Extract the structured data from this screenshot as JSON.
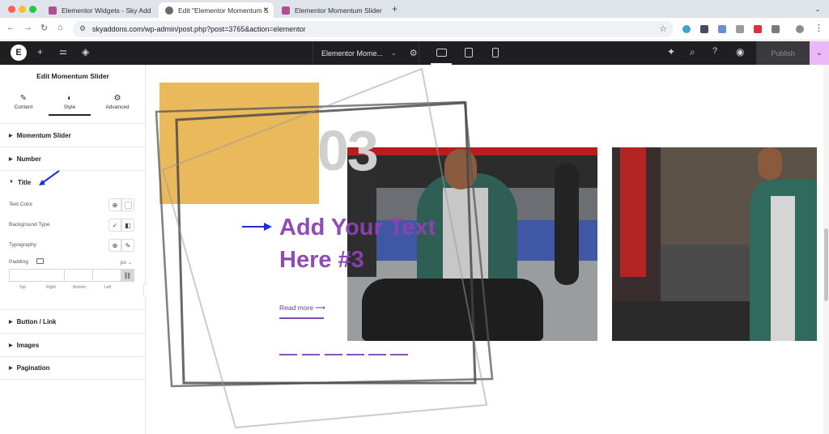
{
  "browser": {
    "tabs": [
      {
        "title": "Elementor Widgets - Sky Add",
        "active": false
      },
      {
        "title": "Edit \"Elementor Momentum S",
        "active": true
      },
      {
        "title": "Elementor Momentum Slider",
        "active": false
      }
    ],
    "new_tab": "+",
    "url": "skyaddons.com/wp-admin/post.php?post=3765&action=elementor"
  },
  "editor_bar": {
    "document_title": "Elementor Mome...",
    "publish_label": "Publish"
  },
  "panel": {
    "title": "Edit Momentum Slider",
    "tabs": [
      {
        "label": "Content",
        "icon": "pencil-icon"
      },
      {
        "label": "Style",
        "icon": "half-circle-icon"
      },
      {
        "label": "Advanced",
        "icon": "gear-icon"
      }
    ],
    "sections_top": [
      "Momentum Slider",
      "Number"
    ],
    "open_section": "Title",
    "controls": {
      "text_color": "Text Color",
      "background_type": "Background Type",
      "typography": "Typography",
      "padding": "Padding",
      "unit": "px",
      "pad_labels": [
        "Top",
        "Right",
        "Bottom",
        "Left"
      ]
    },
    "sections_bottom": [
      "Button / Link",
      "Images",
      "Pagination"
    ]
  },
  "slide": {
    "number": "03",
    "title_line1": "Add Your Text",
    "title_line2": "Here #3",
    "read_more": "Read more"
  },
  "colors": {
    "accent_purple": "#8b43b3",
    "yellow_block": "#e8b14a",
    "publish_menu": "#e9b8f5",
    "annotation_arrow": "#1a2fd6"
  }
}
